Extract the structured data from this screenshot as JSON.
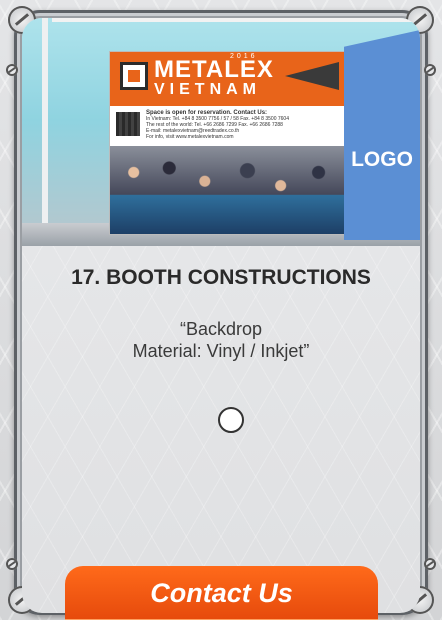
{
  "booth_image": {
    "banner_brand": "METALEX",
    "banner_brand_sub": "VIETNAM",
    "banner_year": "2016",
    "banner_headline": "Space is open for reservation. Contact Us:",
    "banner_line1": "In Vietnam: Tel. +84 8 3500 7756 / 57 / 58  Fax. +84 8 3500 7604",
    "banner_line2": "The rest of the world: Tel. +66 2686 7299  Fax. +66 2686 7288",
    "banner_line3": "E-mail: metalexvietnam@reedtradex.co.th",
    "banner_line4": "For info, visit www.metalexvietnam.com",
    "logo_text": "LOGO",
    "colors": {
      "banner_orange": "#e8641a",
      "logo_panel": "#5b8fd4"
    }
  },
  "card": {
    "title": "17. BOOTH CONSTRUCTIONS",
    "description_line1": "“Backdrop",
    "description_line2": "Material: Vinyl / Inkjet”"
  },
  "cta": {
    "label": "Contact Us",
    "color": "#f05a14"
  }
}
